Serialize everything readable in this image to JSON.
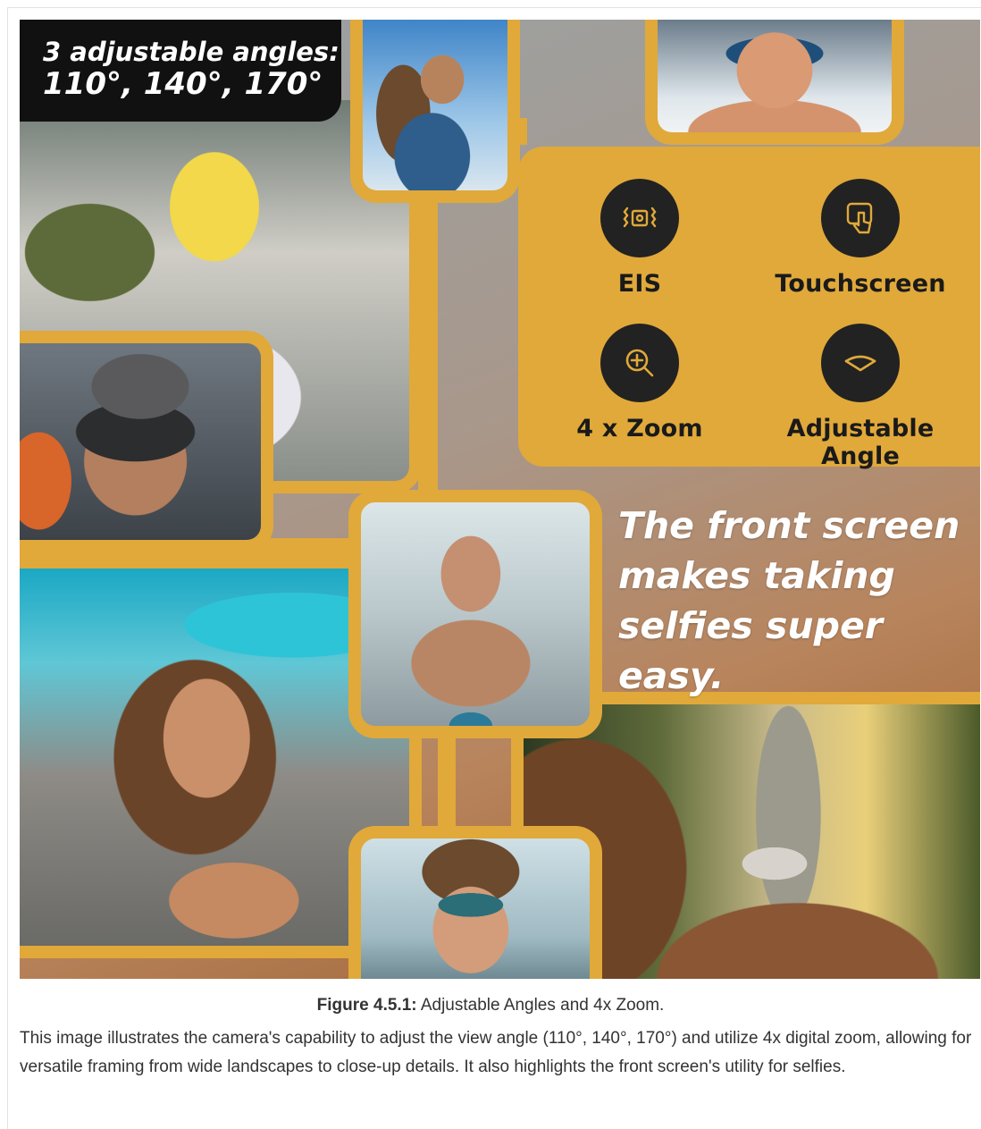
{
  "figure": {
    "angles_heading": {
      "line1": "3 adjustable angles:",
      "line2": "110°, 140°, 170°"
    },
    "features": [
      {
        "label": "EIS",
        "icon": "stabilization-icon"
      },
      {
        "label": "Touchscreen",
        "icon": "touch-icon"
      },
      {
        "label": "4 x Zoom",
        "icon": "zoom-in-icon"
      },
      {
        "label": "Adjustable Angle",
        "icon": "angle-icon"
      }
    ],
    "tagline": {
      "line1": "The front screen",
      "line2": "makes taking",
      "line3": "selfies super easy."
    },
    "colors": {
      "accent": "#e0a93a",
      "icon_bg": "#222222",
      "heading_bg": "#111111"
    }
  },
  "caption": {
    "label": "Figure 4.5.1:",
    "title": " Adjustable Angles and 4x Zoom.",
    "body": "This image illustrates the camera's capability to adjust the view angle (110°, 140°, 170°) and utilize 4x digital zoom, allowing for versatile framing from wide landscapes to close-up details. It also highlights the front screen's utility for selfies."
  }
}
